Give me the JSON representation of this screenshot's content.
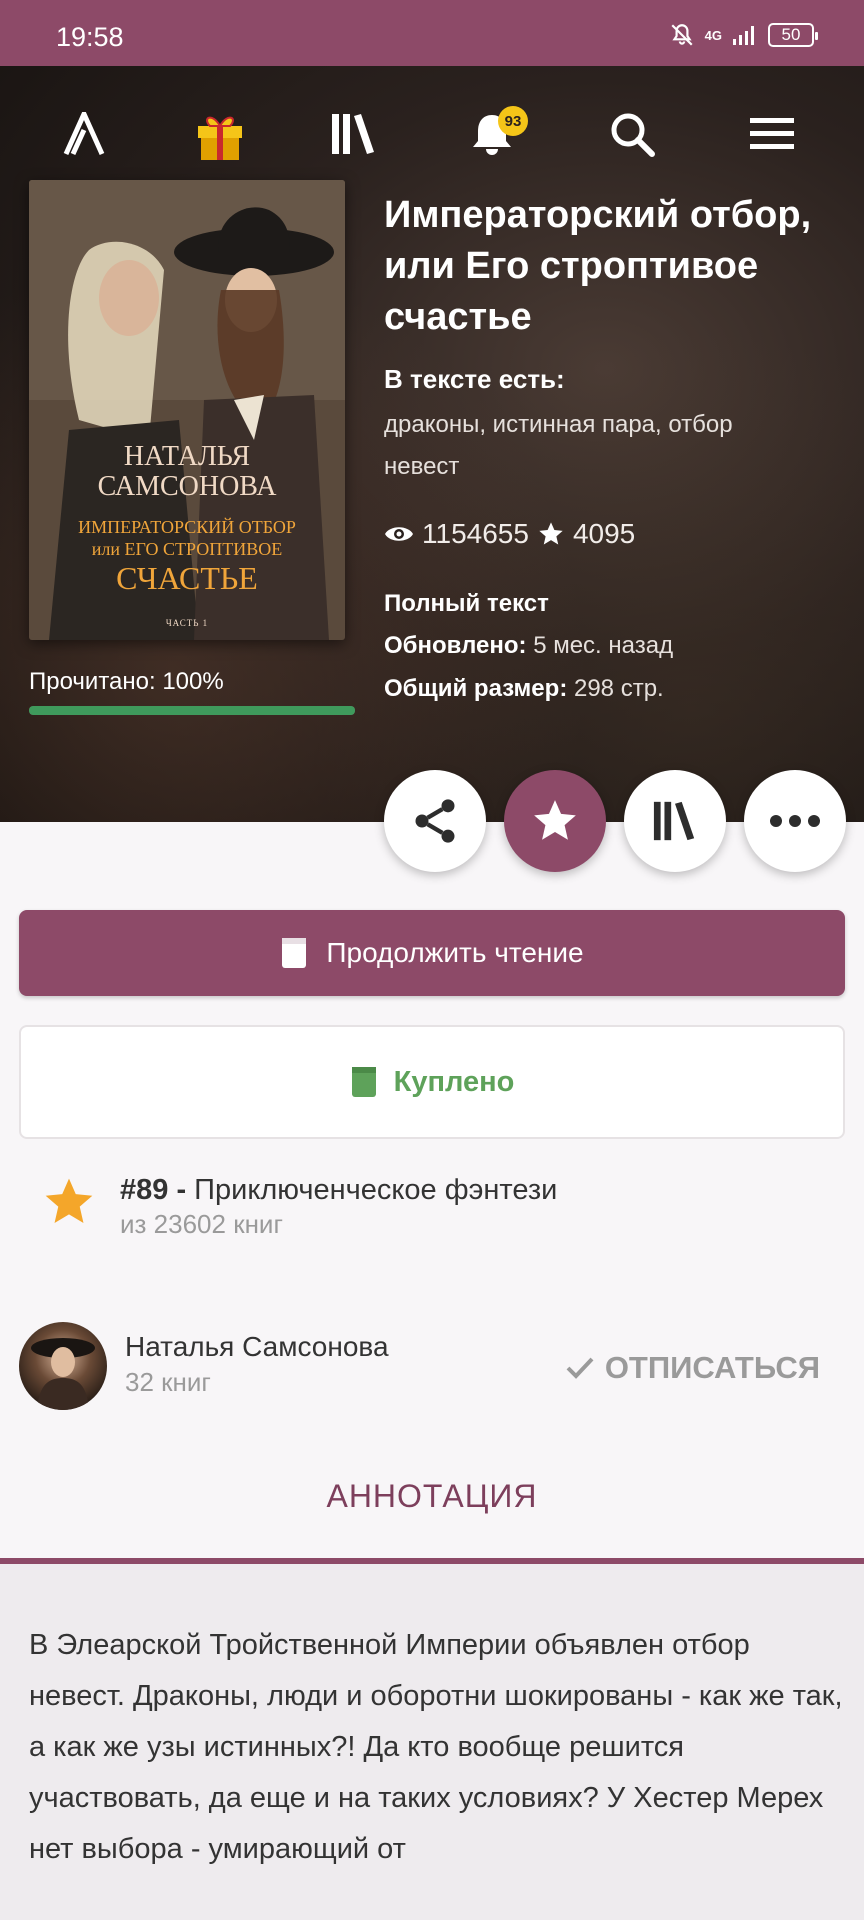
{
  "status_bar": {
    "time": "19:58",
    "network": "4G",
    "battery": "50"
  },
  "nav": {
    "notifications_count": "93"
  },
  "book": {
    "title": "Императорский отбор, или Его строптивое счастье",
    "tags_heading": "В тексте есть:",
    "tags": "драконы, истинная пара, отбор невест",
    "views": "1154655",
    "stars": "4095",
    "status": "Полный текст",
    "updated_label": "Обновлено:",
    "updated_value": "5 мес. назад",
    "size_label": "Общий размер:",
    "size_value": "298 стр.",
    "read_label": "Прочитано: 100%",
    "read_fraction": 1.0
  },
  "cover": {
    "author_line1": "НАТАЛЬЯ",
    "author_line2": "САМСОНОВА",
    "title_line1": "ИМПЕРАТОРСКИЙ ОТБОР",
    "title_line2": "или ЕГО СТРОПТИВОЕ",
    "title_line3": "СЧАСТЬЕ",
    "part": "ЧАСТЬ 1"
  },
  "buttons": {
    "continue": "Продолжить чтение",
    "bought": "Куплено"
  },
  "rank": {
    "position": "#89 -",
    "genre": "Приключенческое фэнтези",
    "of_books": "из 23602 книг"
  },
  "author": {
    "name": "Наталья Самсонова",
    "books": "32 книг",
    "unsubscribe": "ОТПИСАТЬСЯ"
  },
  "annotation": {
    "tab": "АННОТАЦИЯ",
    "text": "В Элеарской Тройственной Империи объявлен отбор невест. Драконы, люди и оборотни шокированы - как же так, а как же узы истинных?! Да кто вообще решится участвовать, да еще и на таких условиях? У Хестер Мерех нет выбора - умирающий от"
  },
  "colors": {
    "brand": "#8d4a68",
    "progress": "#3f9a5c",
    "bought": "#5ea25a",
    "rank_star": "#f4a62a",
    "badge": "#f5c518"
  }
}
